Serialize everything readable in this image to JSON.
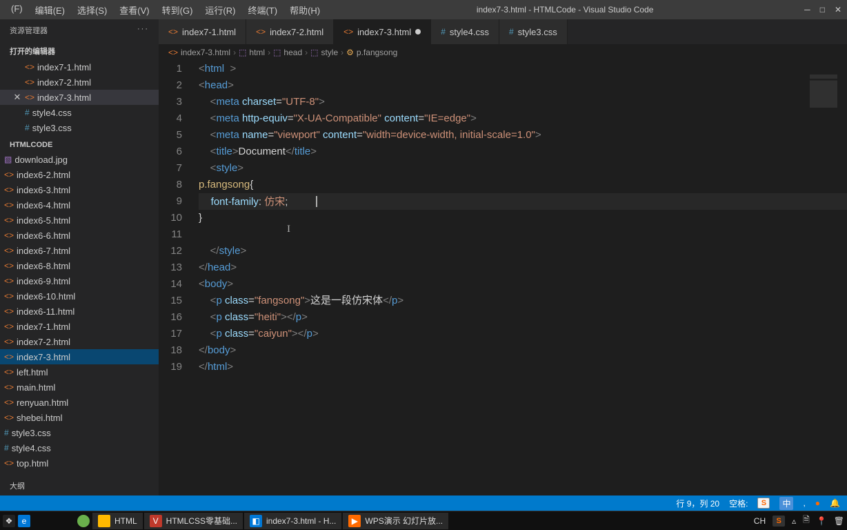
{
  "titlebar": {
    "menus": [
      "(F)",
      "编辑(E)",
      "选择(S)",
      "查看(V)",
      "转到(G)",
      "运行(R)",
      "终端(T)",
      "帮助(H)"
    ],
    "title": "index7-3.html - HTMLCode - Visual Studio Code",
    "min": "─",
    "max": "□",
    "close": "✕"
  },
  "sidebar": {
    "title": "资源管理器",
    "more": "···",
    "open_editors_title": "打开的编辑器",
    "open_editors": [
      {
        "name": "index7-1.html",
        "icon": "html"
      },
      {
        "name": "index7-2.html",
        "icon": "html"
      },
      {
        "name": "index7-3.html",
        "icon": "html",
        "active": true,
        "close": "✕"
      },
      {
        "name": "style4.css",
        "icon": "css"
      },
      {
        "name": "style3.css",
        "icon": "css"
      }
    ],
    "project_title": "HTMLCODE",
    "files": [
      {
        "name": "download.jpg",
        "icon": "img"
      },
      {
        "name": "index6-2.html",
        "icon": "html"
      },
      {
        "name": "index6-3.html",
        "icon": "html"
      },
      {
        "name": "index6-4.html",
        "icon": "html"
      },
      {
        "name": "index6-5.html",
        "icon": "html"
      },
      {
        "name": "index6-6.html",
        "icon": "html"
      },
      {
        "name": "index6-7.html",
        "icon": "html"
      },
      {
        "name": "index6-8.html",
        "icon": "html"
      },
      {
        "name": "index6-9.html",
        "icon": "html"
      },
      {
        "name": "index6-10.html",
        "icon": "html"
      },
      {
        "name": "index6-11.html",
        "icon": "html"
      },
      {
        "name": "index7-1.html",
        "icon": "html"
      },
      {
        "name": "index7-2.html",
        "icon": "html"
      },
      {
        "name": "index7-3.html",
        "icon": "html",
        "selected": true
      },
      {
        "name": "left.html",
        "icon": "html"
      },
      {
        "name": "main.html",
        "icon": "html"
      },
      {
        "name": "renyuan.html",
        "icon": "html"
      },
      {
        "name": "shebei.html",
        "icon": "html"
      },
      {
        "name": "style3.css",
        "icon": "css"
      },
      {
        "name": "style4.css",
        "icon": "css"
      },
      {
        "name": "top.html",
        "icon": "html"
      }
    ],
    "outline_title": "大纲"
  },
  "tabs": [
    {
      "name": "index7-1.html",
      "icon": "html"
    },
    {
      "name": "index7-2.html",
      "icon": "html"
    },
    {
      "name": "index7-3.html",
      "icon": "html",
      "active": true,
      "modified": true
    },
    {
      "name": "style4.css",
      "icon": "css"
    },
    {
      "name": "style3.css",
      "icon": "css"
    }
  ],
  "breadcrumbs": [
    {
      "icon": "html",
      "label": "index7-3.html"
    },
    {
      "icon": "cube",
      "label": "html"
    },
    {
      "icon": "cube",
      "label": "head"
    },
    {
      "icon": "cube",
      "label": "style"
    },
    {
      "icon": "yellow",
      "label": "p.fangsong"
    }
  ],
  "code_lines": 19,
  "statusbar": {
    "pos": "行 9，列 20",
    "spaces": "空格:",
    "lang_badges": [
      "中",
      ",",
      "●"
    ]
  },
  "taskbar": {
    "items": [
      {
        "label": "HTML",
        "icon": "folder"
      },
      {
        "label": "HTMLCSS零基础...",
        "icon": "red"
      },
      {
        "label": "index7-3.html - H...",
        "icon": "vs"
      },
      {
        "label": "WPS演示 幻灯片放...",
        "icon": "wps"
      }
    ],
    "ime": "CH",
    "sogou": "S"
  }
}
